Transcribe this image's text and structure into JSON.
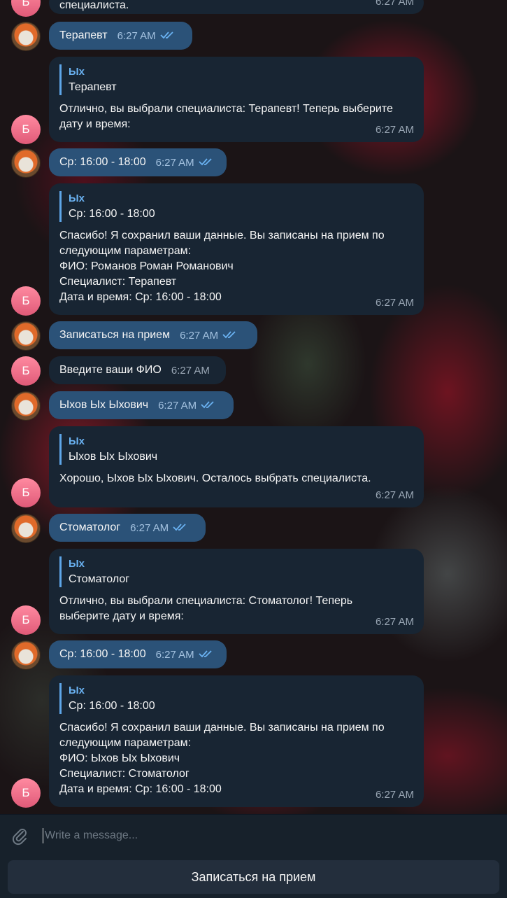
{
  "bot_avatar_letter": "Б",
  "messages": [
    {
      "kind": "in",
      "text": "специалиста.",
      "time": "6:27 AM"
    },
    {
      "kind": "out",
      "text": "Терапевт",
      "time": "6:27 AM"
    },
    {
      "kind": "in",
      "quote_author": "Ых",
      "quote_text": "Терапевт",
      "lines": [
        "Отлично, вы выбрали специалиста: Терапевт! Теперь выберите",
        "дату и время:"
      ],
      "time": "6:27 AM"
    },
    {
      "kind": "out",
      "text": "Ср: 16:00 - 18:00",
      "time": "6:27 AM"
    },
    {
      "kind": "in",
      "quote_author": "Ых",
      "quote_text": "Ср: 16:00 - 18:00",
      "lines": [
        "Спасибо! Я сохранил ваши данные. Вы записаны на прием по",
        "следующим параметрам:",
        "ФИО: Романов Роман Романович",
        "Специалист: Терапевт",
        "Дата и время: Ср: 16:00 - 18:00"
      ],
      "time": "6:27 AM"
    },
    {
      "kind": "out",
      "text": "Записаться на прием",
      "time": "6:27 AM"
    },
    {
      "kind": "in",
      "text": "Введите ваши ФИО",
      "time": "6:27 AM"
    },
    {
      "kind": "out",
      "text": "Ыхов Ых Ыхович",
      "time": "6:27 AM"
    },
    {
      "kind": "in",
      "quote_author": "Ых",
      "quote_text": "Ыхов Ых Ыхович",
      "lines": [
        "Хорошо, Ыхов Ых Ыхович. Осталось выбрать специалиста."
      ],
      "time": "6:27 AM"
    },
    {
      "kind": "out",
      "text": "Стоматолог",
      "time": "6:27 AM"
    },
    {
      "kind": "in",
      "quote_author": "Ых",
      "quote_text": "Стоматолог",
      "lines": [
        "Отлично, вы выбрали специалиста: Стоматолог! Теперь",
        "выберите дату и время:"
      ],
      "time": "6:27 AM"
    },
    {
      "kind": "out",
      "text": "Ср: 16:00 - 18:00",
      "time": "6:27 AM"
    },
    {
      "kind": "in",
      "quote_author": "Ых",
      "quote_text": "Ср: 16:00 - 18:00",
      "lines": [
        "Спасибо! Я сохранил ваши данные. Вы записаны на прием по",
        "следующим параметрам:",
        "ФИО: Ыхов Ых Ыхович",
        "Специалист: Стоматолог",
        "Дата и время: Ср: 16:00 - 18:00"
      ],
      "time": "6:27 AM"
    }
  ],
  "composer": {
    "placeholder": "Write a message...",
    "value": ""
  },
  "keyboard": {
    "button_label": "Записаться на прием"
  },
  "colors": {
    "outgoing_bubble": "#2b5278",
    "incoming_bubble": "#182533",
    "accent": "#6ab2f2"
  },
  "icons": {
    "attach": "paperclip-icon",
    "read": "double-check-icon"
  }
}
